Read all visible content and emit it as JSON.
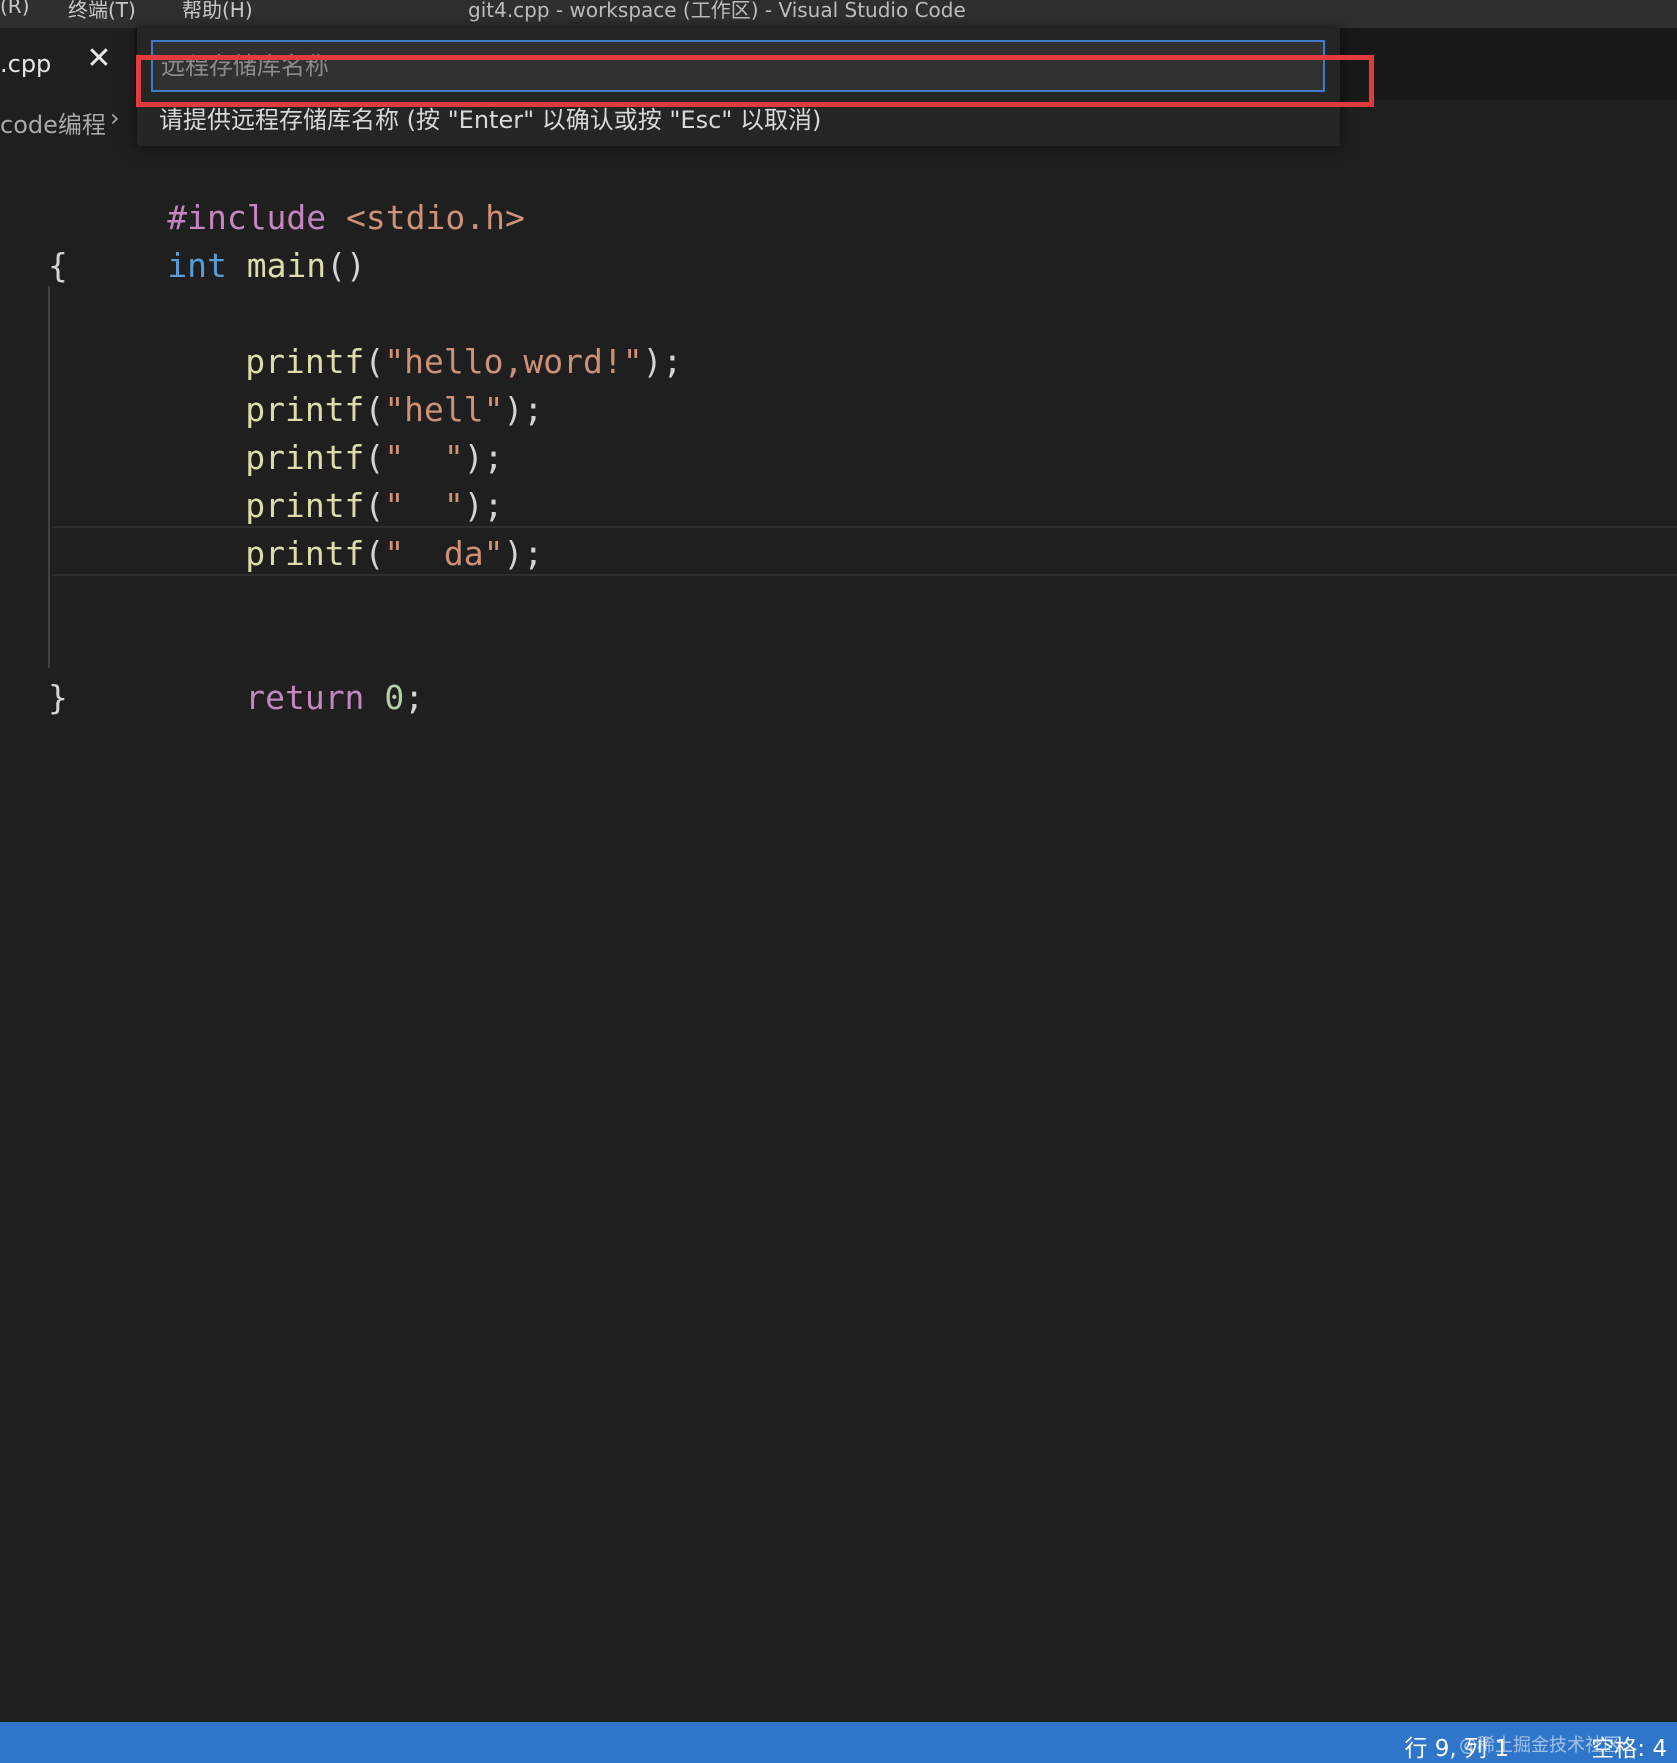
{
  "menu": {
    "items": [
      "(R)",
      "终端(T)",
      "帮助(H)"
    ]
  },
  "window": {
    "title": "git4.cpp - workspace (工作区) - Visual Studio Code"
  },
  "tab": {
    "label": ".cpp",
    "close_icon": "close-icon"
  },
  "breadcrumb": {
    "label": "code编程",
    "chevron": "›"
  },
  "quick_input": {
    "placeholder": "远程存储库名称",
    "value": "",
    "message": "请提供远程存储库名称 (按 \"Enter\" 以确认或按 \"Esc\" 以取消)"
  },
  "code": {
    "lines": [
      {
        "include_kw": "#include",
        "header": "<stdio.h>"
      },
      {
        "type": "int",
        "name": "main",
        "parens": "()"
      },
      {
        "text": "{"
      },
      {
        "fn": "printf",
        "open": "(",
        "str": "\"hello,word!\"",
        "close": ");"
      },
      {
        "fn": "printf",
        "open": "(",
        "str": "\"hell\"",
        "close": ");"
      },
      {
        "fn": "printf",
        "open": "(",
        "str": "\"  \"",
        "close": ");"
      },
      {
        "fn": "printf",
        "open": "(",
        "str": "\"  \"",
        "close": ");"
      },
      {
        "fn": "printf",
        "open": "(",
        "str": "\"  da\"",
        "close": ");"
      },
      {
        "kw": "return",
        "num": "0",
        "semi": ";"
      },
      {
        "text": "}"
      }
    ]
  },
  "status": {
    "position": "行 9, 列 1",
    "indent": "空格: 4",
    "watermark": "@稀土掘金技术社区"
  },
  "colors": {
    "editor_bg": "#1f1f1f",
    "statusbar_bg": "#2f75c9",
    "highlight_border": "#e23a3f",
    "input_border": "#3e7cc9"
  }
}
